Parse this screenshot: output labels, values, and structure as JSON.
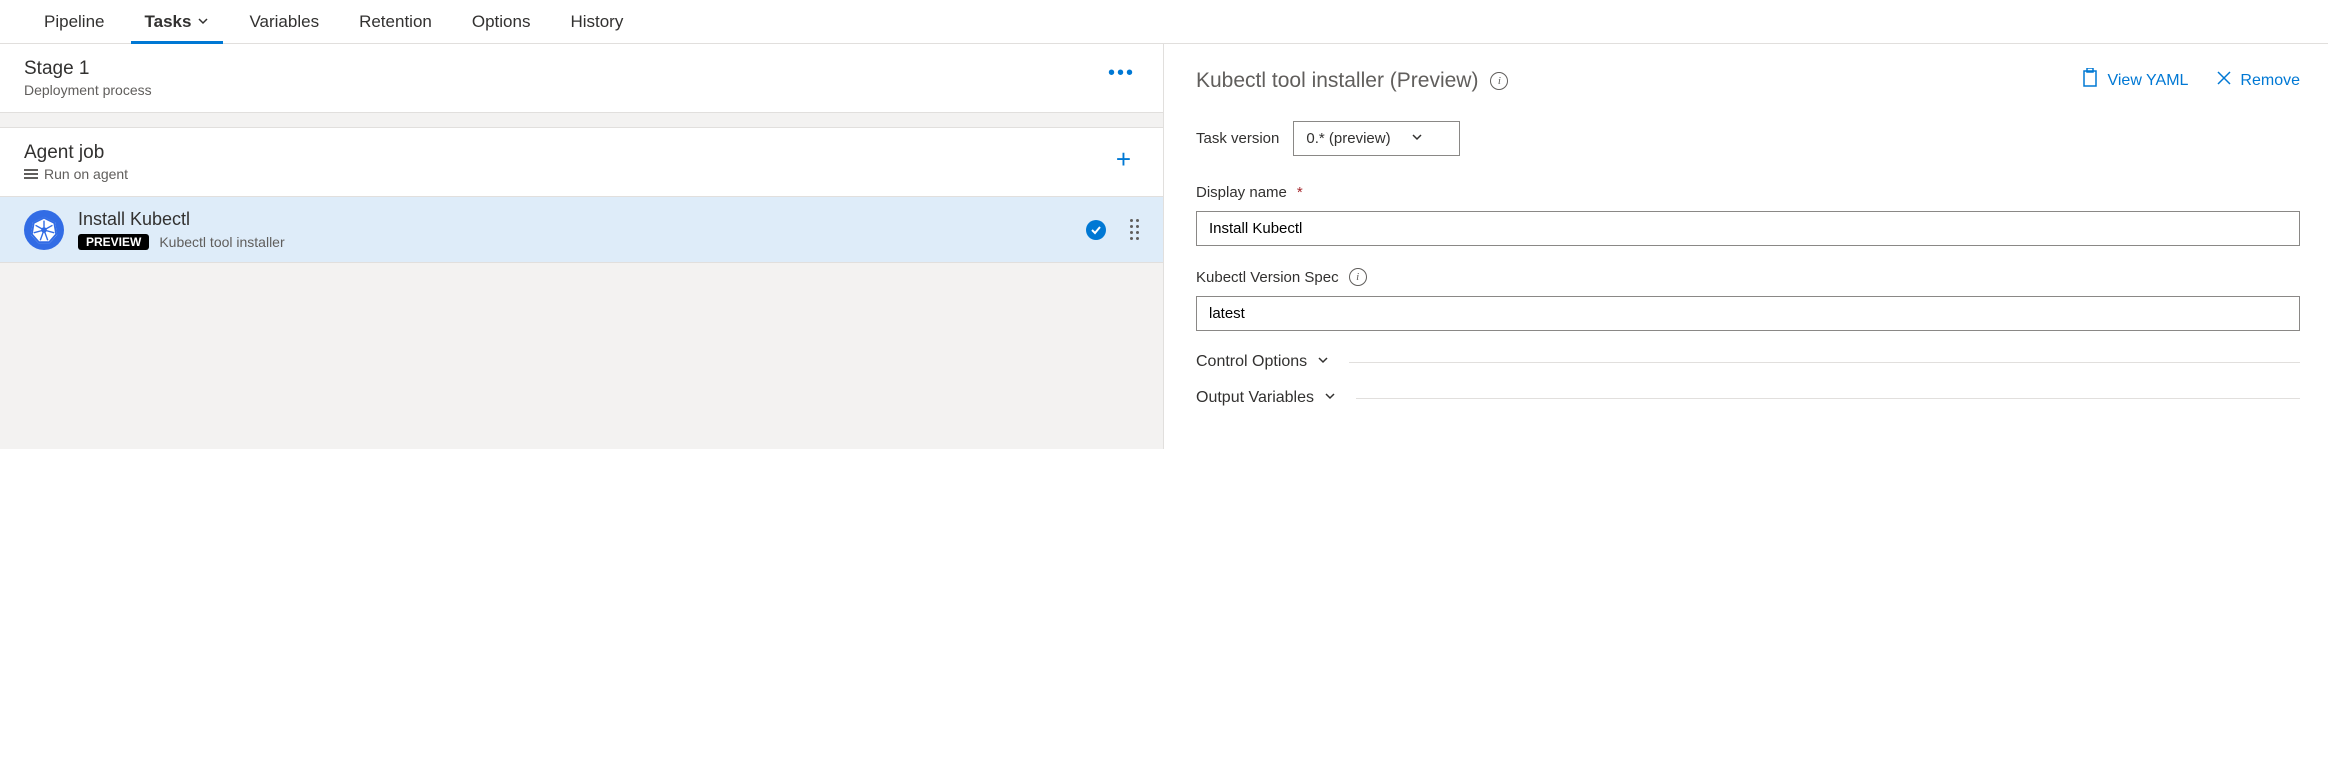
{
  "tabs": {
    "pipeline": "Pipeline",
    "tasks": "Tasks",
    "variables": "Variables",
    "retention": "Retention",
    "options": "Options",
    "history": "History"
  },
  "stage": {
    "title": "Stage 1",
    "subtitle": "Deployment process"
  },
  "job": {
    "title": "Agent job",
    "subtitle": "Run on agent"
  },
  "task": {
    "name": "Install Kubectl",
    "badge": "PREVIEW",
    "description": "Kubectl tool installer"
  },
  "details": {
    "title": "Kubectl tool installer (Preview)",
    "view_yaml": "View YAML",
    "remove": "Remove",
    "task_version_label": "Task version",
    "task_version_value": "0.* (preview)",
    "display_name_label": "Display name",
    "display_name_value": "Install Kubectl",
    "version_spec_label": "Kubectl Version Spec",
    "version_spec_value": "latest",
    "control_options": "Control Options",
    "output_variables": "Output Variables"
  }
}
